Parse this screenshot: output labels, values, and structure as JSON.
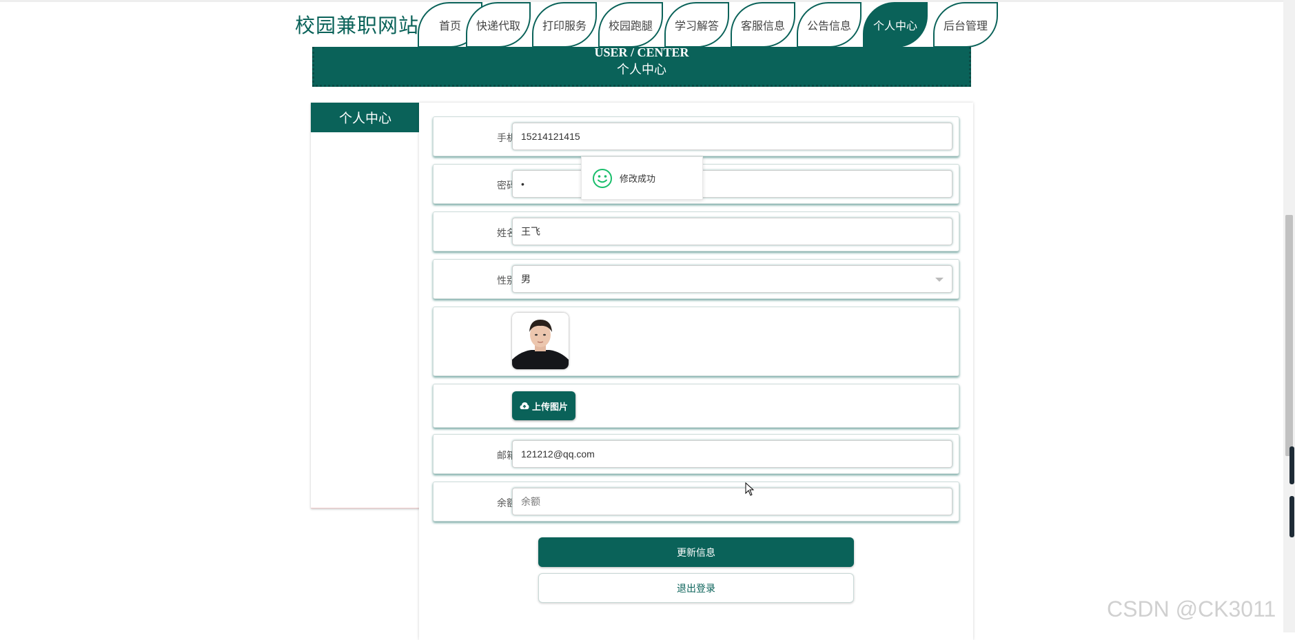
{
  "header": {
    "site_title": "校园兼职网站",
    "nav": [
      {
        "label": "首页",
        "active": false
      },
      {
        "label": "快递代取",
        "active": false
      },
      {
        "label": "打印服务",
        "active": false
      },
      {
        "label": "校园跑腿",
        "active": false
      },
      {
        "label": "学习解答",
        "active": false
      },
      {
        "label": "客服信息",
        "active": false
      },
      {
        "label": "公告信息",
        "active": false
      },
      {
        "label": "个人中心",
        "active": true
      },
      {
        "label": "后台管理",
        "active": false
      }
    ]
  },
  "banner": {
    "en": "USER / CENTER",
    "cn": "个人中心"
  },
  "sidebar": {
    "title": "个人中心"
  },
  "form": {
    "phone": {
      "label": "手机",
      "value": "15214121415"
    },
    "password": {
      "label": "密码",
      "value": "•"
    },
    "name": {
      "label": "姓名",
      "value": "王飞"
    },
    "gender": {
      "label": "性别",
      "value": "男"
    },
    "upload_label": "上传图片",
    "email": {
      "label": "邮箱",
      "value": "121212@qq.com"
    },
    "balance": {
      "label": "余额",
      "value": "",
      "placeholder": "余额"
    },
    "update_button": "更新信息",
    "logout_button": "退出登录"
  },
  "toast": {
    "message": "修改成功",
    "icon": "smile-icon"
  },
  "watermark": "CSDN @CK3011",
  "colors": {
    "primary": "#0a6259",
    "success": "#19be6b"
  }
}
